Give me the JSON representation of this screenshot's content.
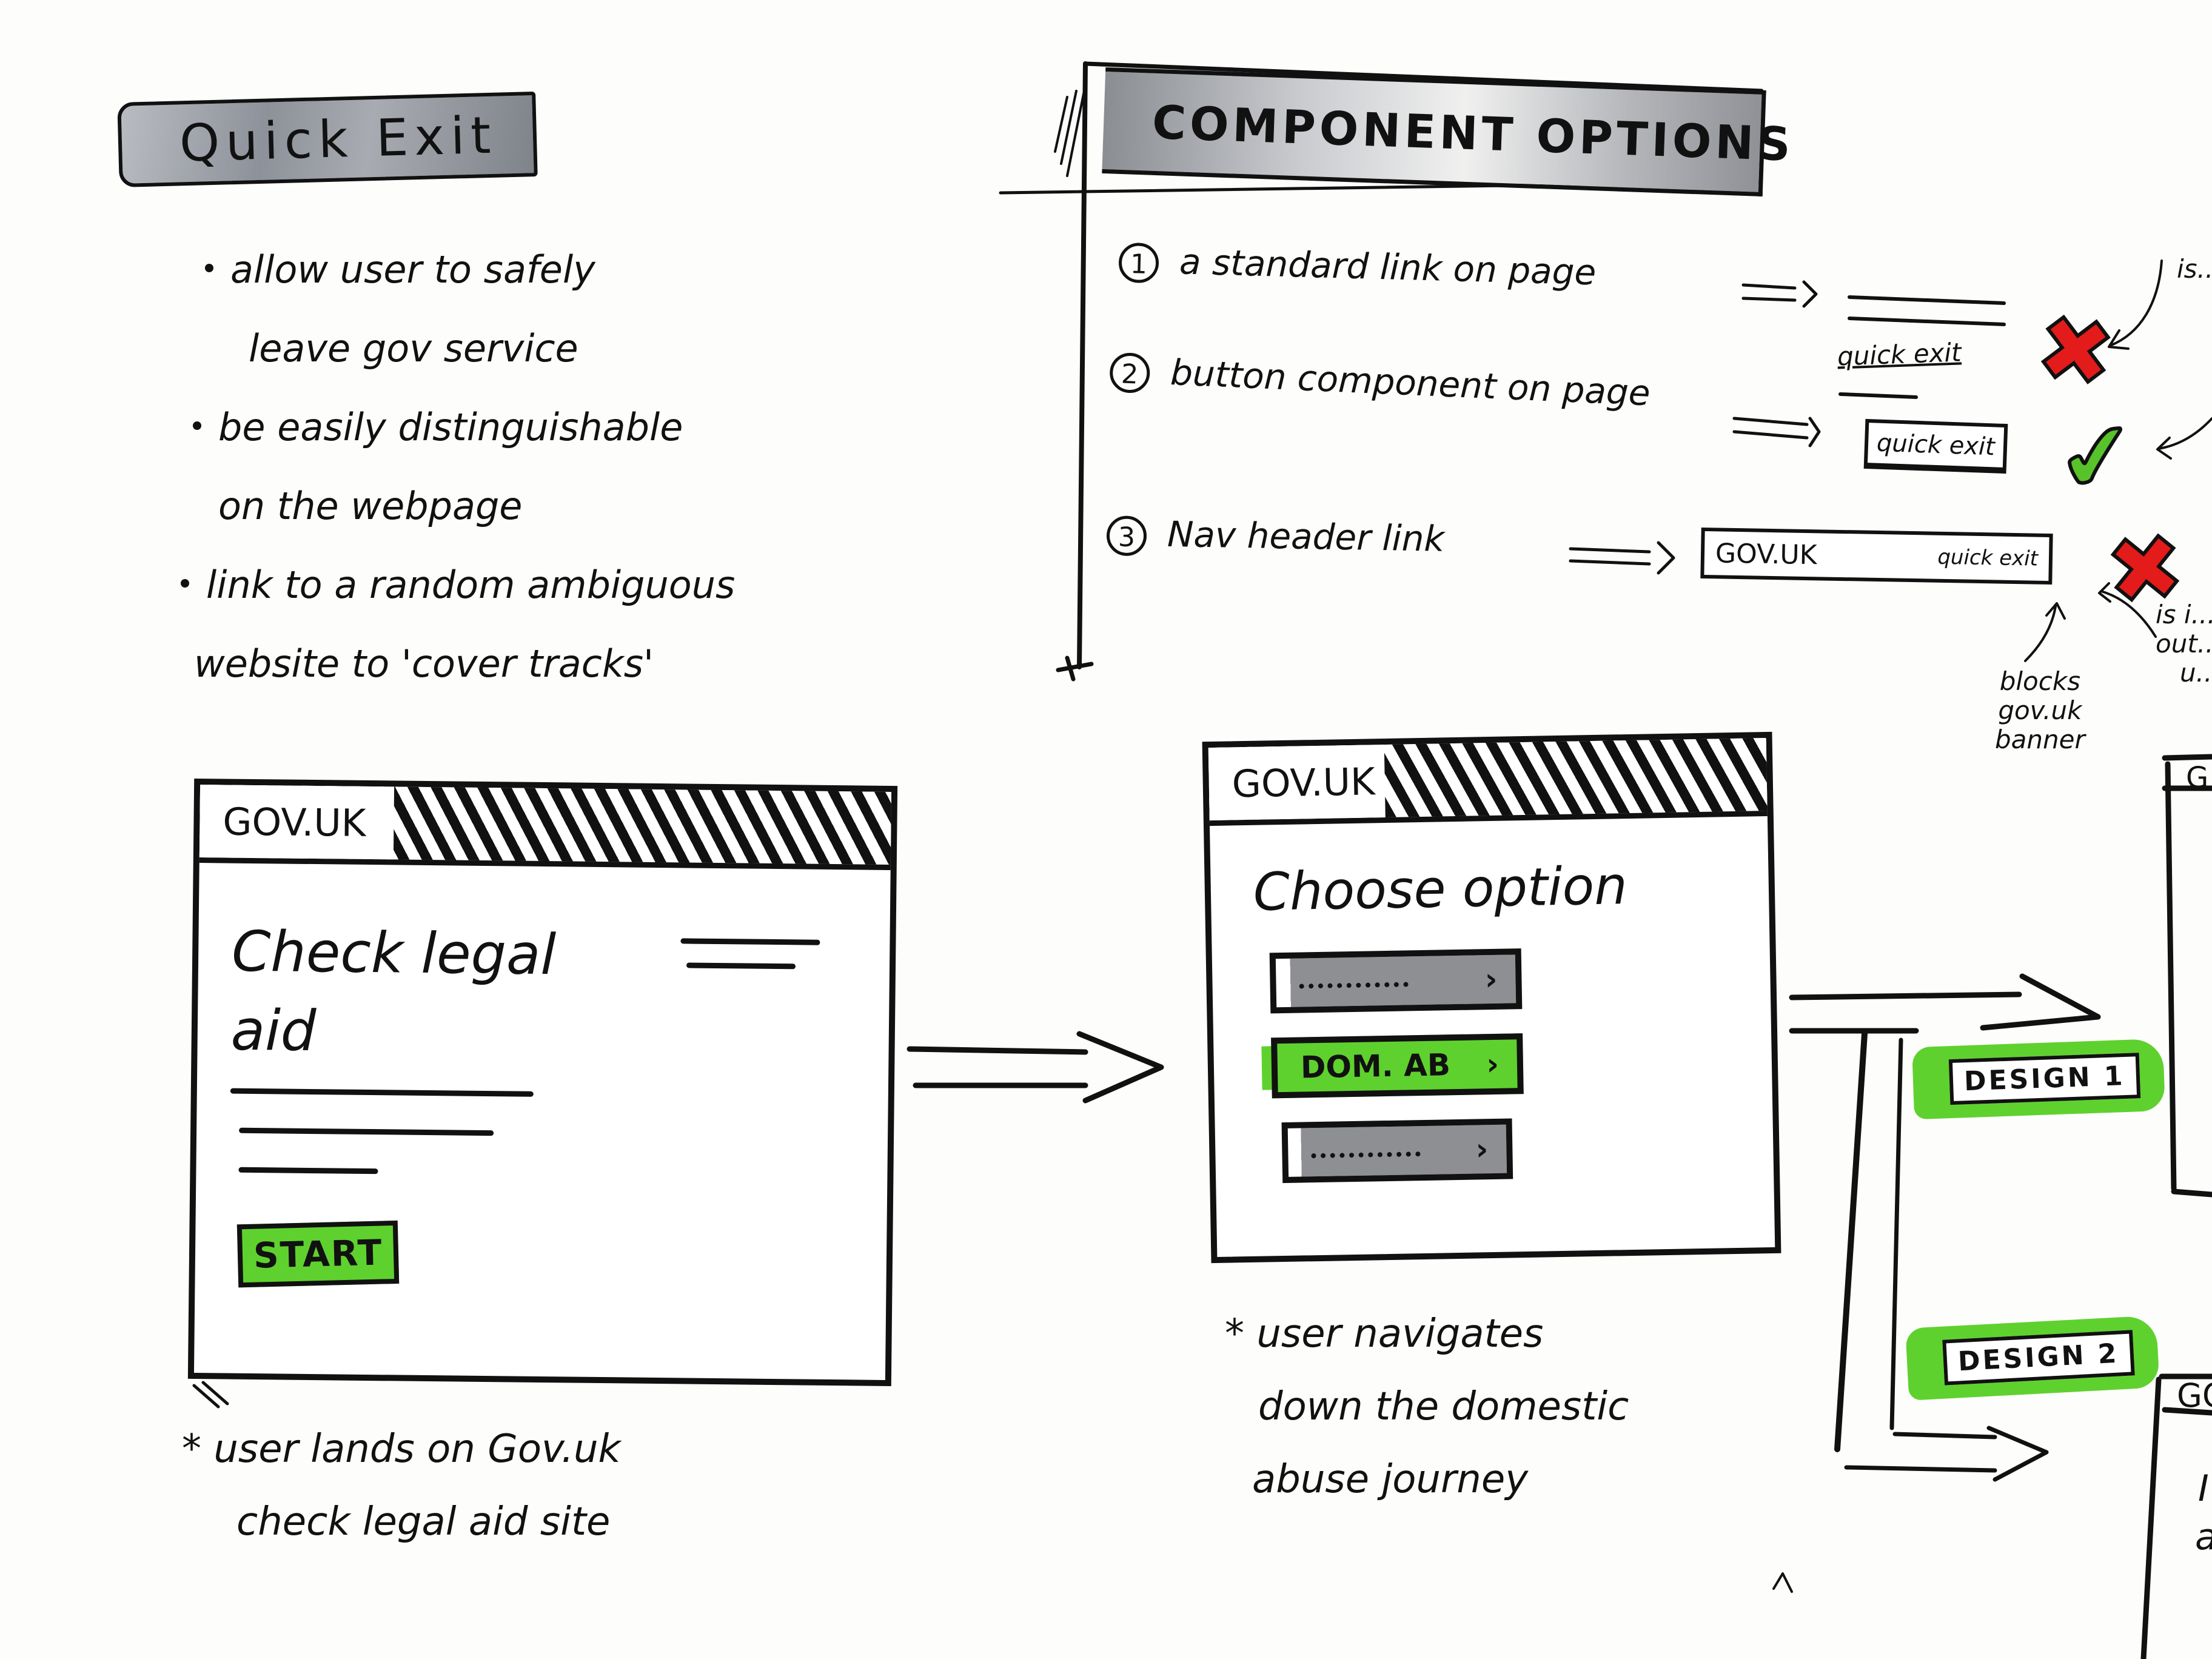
{
  "quick_exit": {
    "title": "Quick Exit",
    "bullets": [
      {
        "lines": [
          "allow user to safely",
          "leave gov service"
        ]
      },
      {
        "lines": [
          "be easily distinguishable",
          "on the webpage"
        ]
      },
      {
        "lines": [
          "link to a random ambiguous",
          "website to 'cover tracks'"
        ]
      }
    ]
  },
  "component_options": {
    "title": "COMPONENT OPTIONS",
    "options": [
      {
        "number": "1",
        "label": "a standard link on page",
        "arrow": "=>",
        "example_text": "quick exit",
        "verdict": "rejected",
        "verdict_icon": "red-cross-icon",
        "side_note": "is... o..."
      },
      {
        "number": "2",
        "label": "button component on page",
        "arrow": "=>",
        "example_text": "quick exit",
        "verdict": "accepted",
        "verdict_icon": "green-tick-icon"
      },
      {
        "number": "3",
        "label": "Nav header link",
        "arrow": "=>",
        "example_logo": "GOV.UK",
        "example_link": "quick exit",
        "verdict": "rejected",
        "verdict_icon": "red-cross-icon",
        "annotation_left": [
          "blocks",
          "gov.uk",
          "banner"
        ],
        "annotation_right": [
          "is i...",
          "out...",
          "u..."
        ]
      }
    ]
  },
  "wireframes": [
    {
      "header_logo": "GOV.UK",
      "title_lines": [
        "Check legal",
        "aid"
      ],
      "button_label": "START",
      "caption": [
        "* user lands on Gov.uk",
        "check legal aid site"
      ]
    },
    {
      "header_logo": "GOV.UK",
      "title": "Choose option",
      "options": [
        {
          "label": "",
          "style": "grey",
          "chevron": "›"
        },
        {
          "label": "DOM. AB",
          "style": "green",
          "chevron": "›"
        },
        {
          "label": "",
          "style": "grey",
          "chevron": "›"
        }
      ],
      "caption": [
        "* user navigates",
        "down the domestic",
        "abuse journey"
      ]
    }
  ],
  "branches": [
    {
      "label": "DESIGN 1"
    },
    {
      "label": "DESIGN 2"
    }
  ],
  "partial_right": {
    "top_logo_fragment": "G",
    "bottom_logo_fragment": "GO",
    "bottom_text_fragments": [
      "I",
      "a"
    ]
  },
  "colors": {
    "ink": "#111111",
    "paper": "#fdfdfb",
    "highlight_green": "#5fd12e",
    "cross_red": "#e31b1b",
    "tick_green": "#58c22a",
    "marker_grey": "#8d8f93"
  }
}
